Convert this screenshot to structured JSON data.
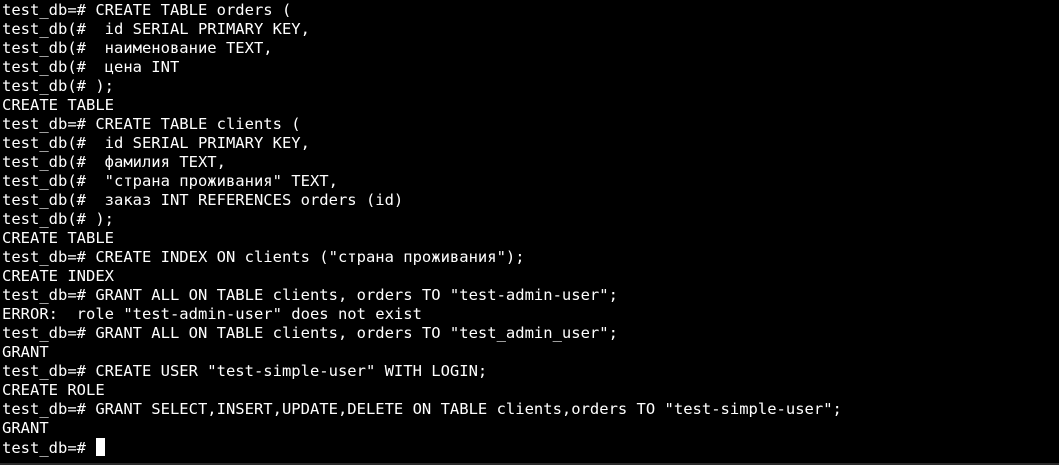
{
  "terminal": {
    "lines": [
      "test_db=# CREATE TABLE orders (",
      "test_db(#  id SERIAL PRIMARY KEY,",
      "test_db(#  наименование TEXT,",
      "test_db(#  цена INT",
      "test_db(# );",
      "CREATE TABLE",
      "test_db=# CREATE TABLE clients (",
      "test_db(#  id SERIAL PRIMARY KEY,",
      "test_db(#  фамилия TEXT,",
      "test_db(#  \"страна проживания\" TEXT,",
      "test_db(#  заказ INT REFERENCES orders (id)",
      "test_db(# );",
      "CREATE TABLE",
      "test_db=# CREATE INDEX ON clients (\"страна проживания\");",
      "CREATE INDEX",
      "test_db=# GRANT ALL ON TABLE clients, orders TO \"test-admin-user\";",
      "ERROR:  role \"test-admin-user\" does not exist",
      "test_db=# GRANT ALL ON TABLE clients, orders TO \"test_admin_user\";",
      "GRANT",
      "test_db=# CREATE USER \"test-simple-user\" WITH LOGIN;",
      "CREATE ROLE",
      "test_db=# GRANT SELECT,INSERT,UPDATE,DELETE ON TABLE clients,orders TO \"test-simple-user\";",
      "GRANT"
    ],
    "prompt": "test_db=# ",
    "colors": {
      "background": "#000000",
      "foreground": "#ffffff"
    }
  }
}
